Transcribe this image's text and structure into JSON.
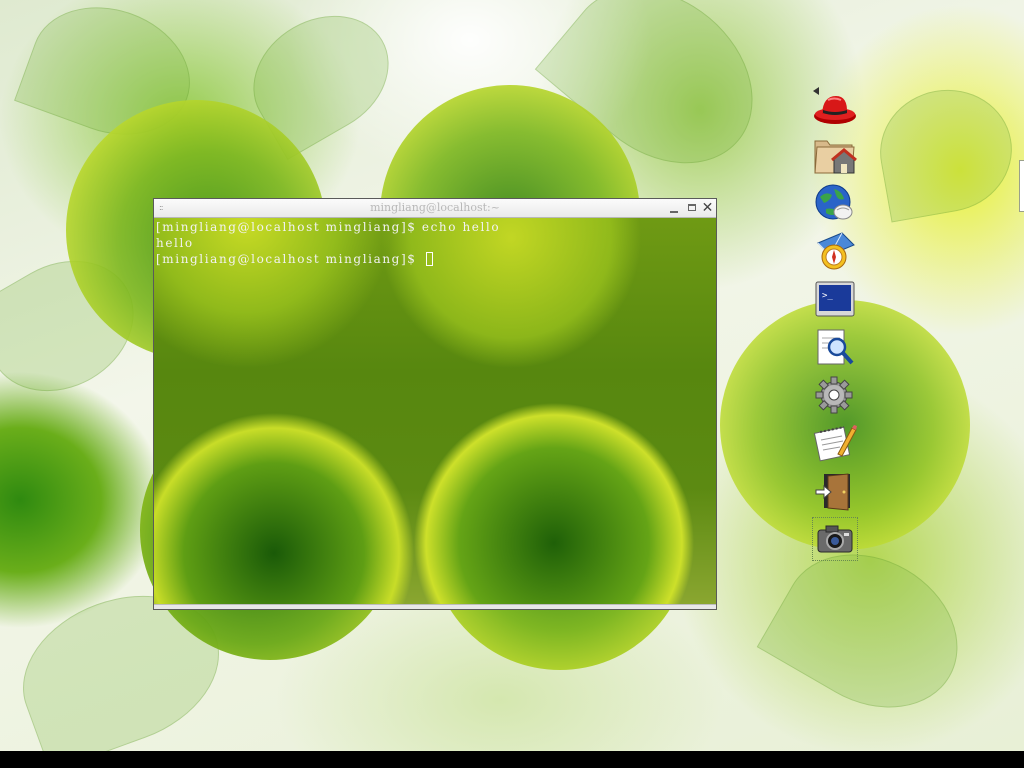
{
  "desktop": {
    "wallpaper": "green-leaves-bubbles",
    "accent_color": "#7bb61c"
  },
  "terminal": {
    "title": "mingliang@localhost:~",
    "lines": [
      "[mingliang@localhost mingliang]$ echo hello",
      "hello",
      "[mingliang@localhost mingliang]$ "
    ],
    "text_color": "#f2f2f2"
  },
  "dock": {
    "collapse_arrow": "left-arrow-icon",
    "items": [
      {
        "name": "redhat-menu-icon"
      },
      {
        "name": "home-folder-icon"
      },
      {
        "name": "web-browser-icon"
      },
      {
        "name": "evolution-mail-icon"
      },
      {
        "name": "terminal-icon"
      },
      {
        "name": "search-files-icon"
      },
      {
        "name": "settings-gear-icon"
      },
      {
        "name": "text-editor-icon"
      },
      {
        "name": "logout-door-icon"
      },
      {
        "name": "screenshot-camera-icon"
      }
    ]
  }
}
